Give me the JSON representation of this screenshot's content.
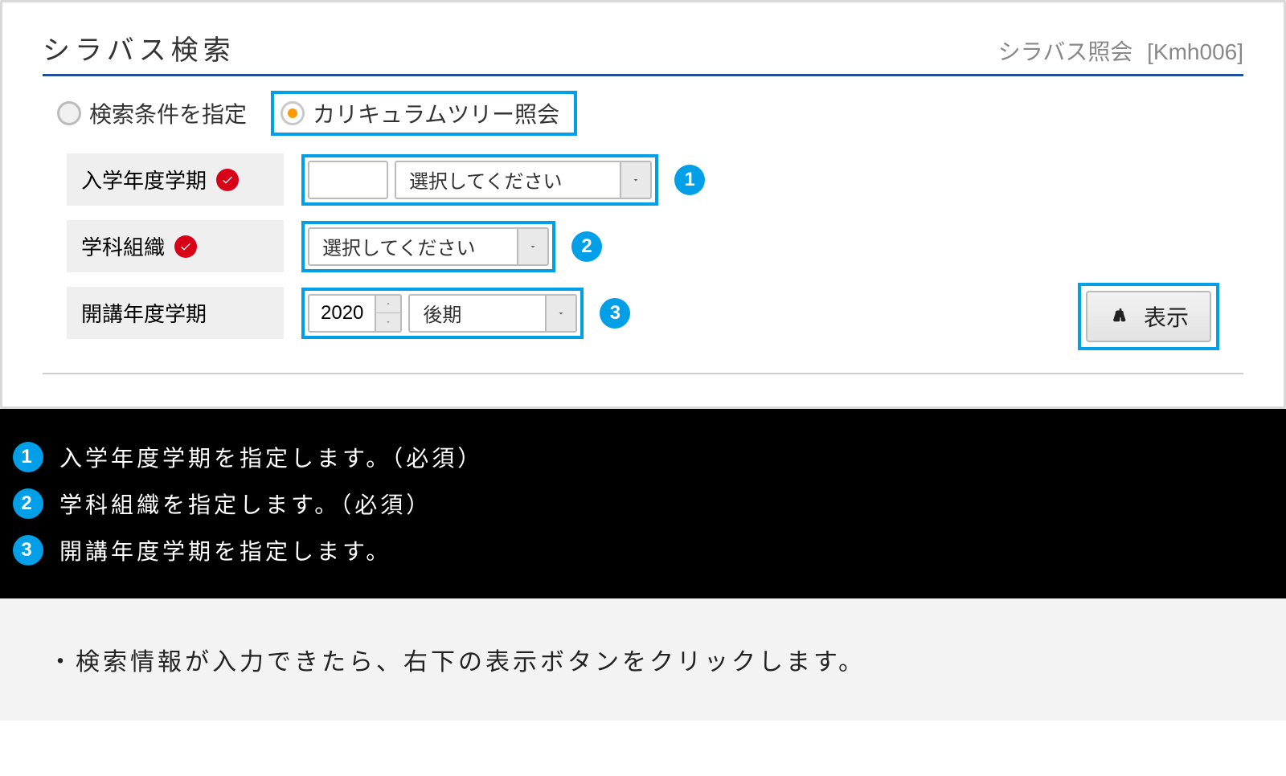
{
  "header": {
    "title": "シラバス検索",
    "meta_label": "シラバス照会",
    "meta_code": "[Kmh006]"
  },
  "tabs": {
    "search_cond": "検索条件を指定",
    "curriculum_tree": "カリキュラムツリー照会"
  },
  "form": {
    "row1": {
      "label": "入学年度学期",
      "text_value": "",
      "select_value": "選択してください",
      "badge": "1"
    },
    "row2": {
      "label": "学科組織",
      "select_value": "選択してください",
      "badge": "2"
    },
    "row3": {
      "label": "開講年度学期",
      "year_value": "2020",
      "term_value": "後期",
      "badge": "3"
    },
    "submit_label": "表示"
  },
  "legend": {
    "items": [
      {
        "n": "1",
        "text": "入学年度学期を指定します。（必須）"
      },
      {
        "n": "2",
        "text": "学科組織を指定します。（必須）"
      },
      {
        "n": "3",
        "text": "開講年度学期を指定します。"
      }
    ]
  },
  "note": "・検索情報が入力できたら、右下の表示ボタンをクリックします。"
}
